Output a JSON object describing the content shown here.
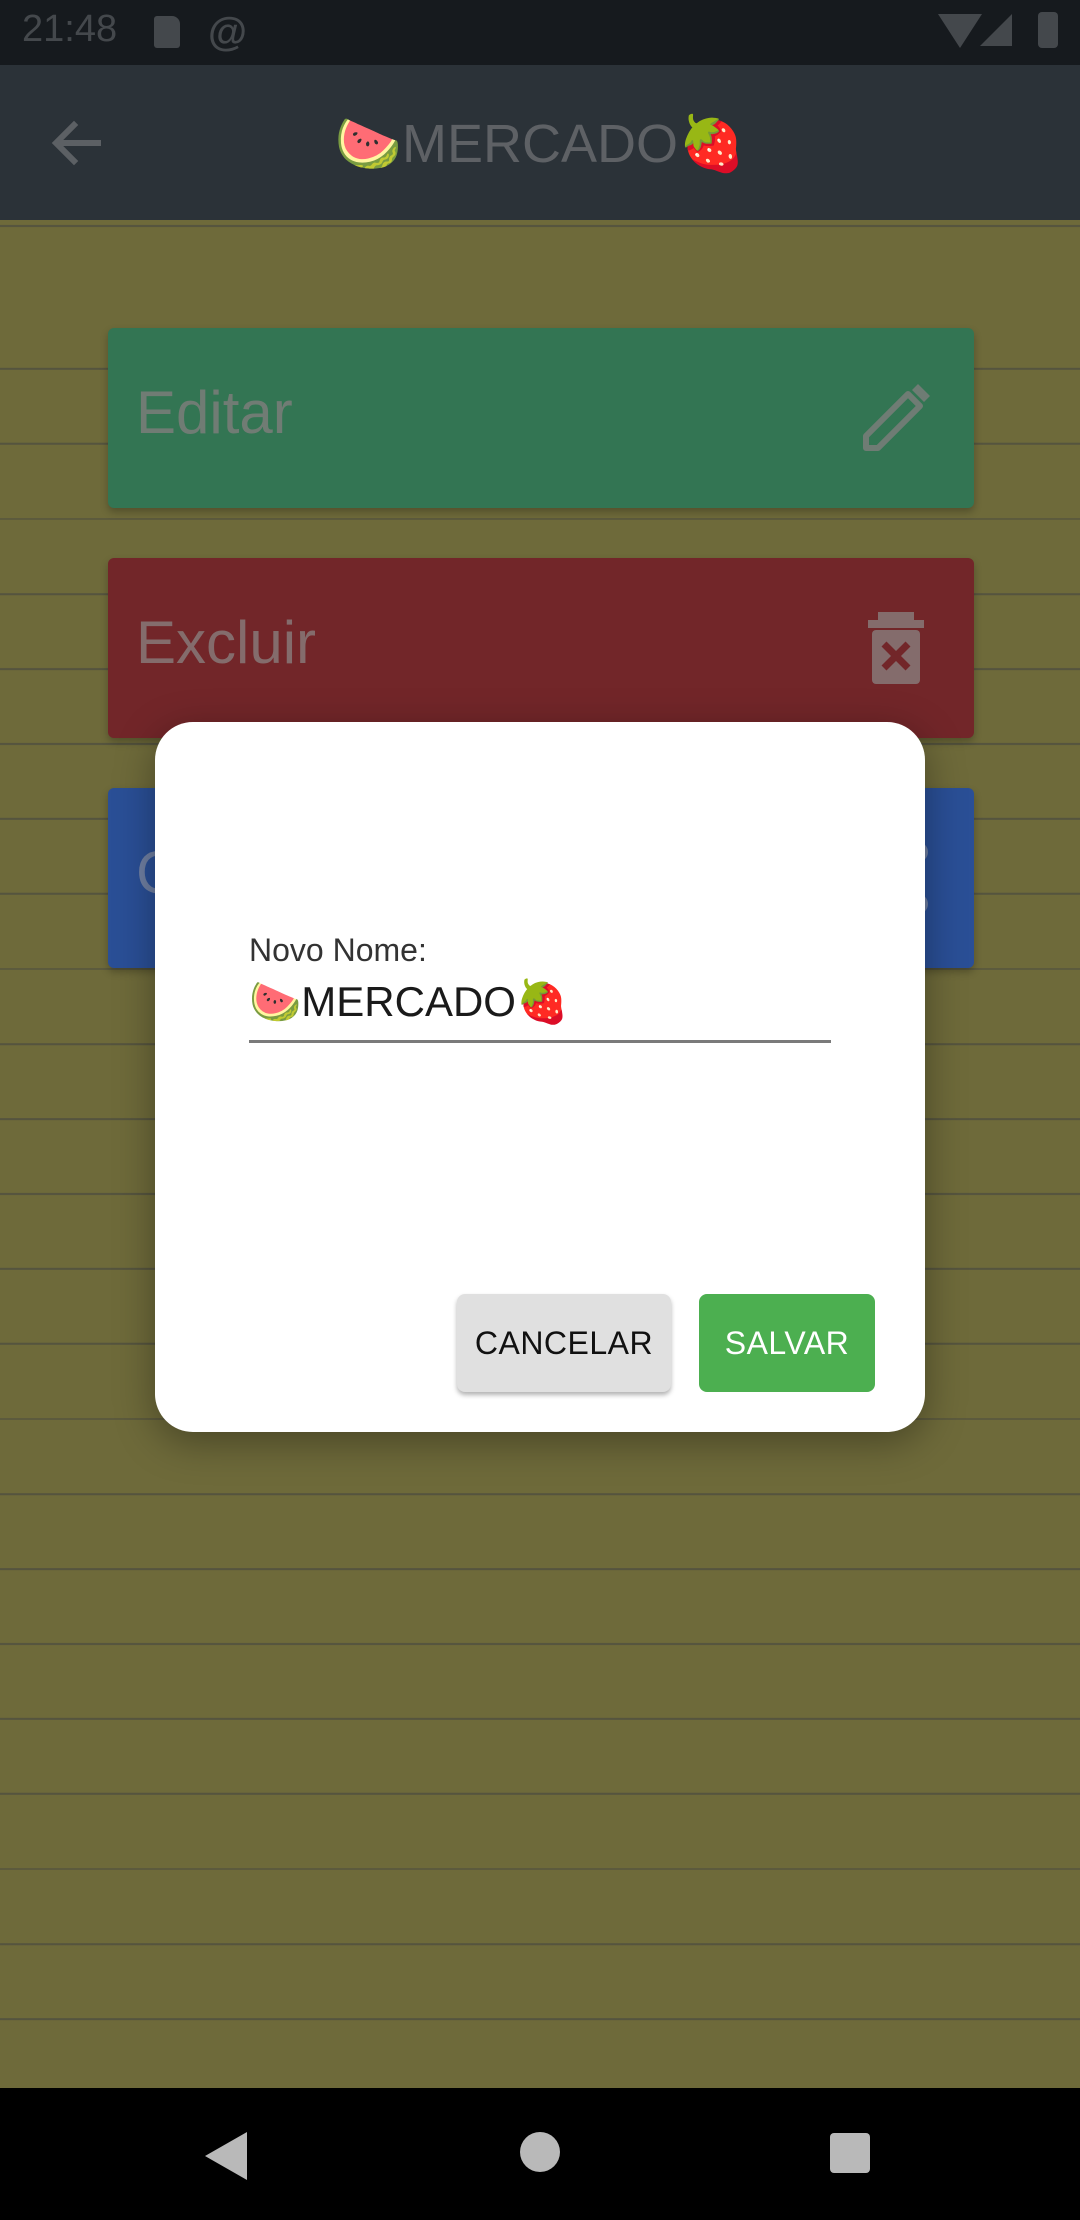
{
  "status_bar": {
    "time": "21:48",
    "icons": [
      "sd-card-icon",
      "at-icon",
      "wifi-icon",
      "signal-icon",
      "battery-icon"
    ]
  },
  "app_bar": {
    "title": "🍉MERCADO🍓",
    "back_icon": "arrow-back-icon"
  },
  "menu": {
    "items": [
      {
        "label": "Editar",
        "icon": "pencil-icon",
        "color": "#337553"
      },
      {
        "label": "Excluir",
        "icon": "trash-icon",
        "color": "#722629"
      },
      {
        "label": "C",
        "icon": "share-icon",
        "color": "#2a4f96"
      }
    ]
  },
  "dialog": {
    "field_label": "Novo Nome:",
    "field_value": "🍉MERCADO🍓",
    "cancel_label": "CANCELAR",
    "save_label": "SALVAR"
  },
  "colors": {
    "app_bar": "#2b3238",
    "page": "#6e6a3a",
    "save": "#4caf50",
    "cancel": "#e0e0e0"
  },
  "nav_bar": {
    "icons": [
      "nav-back-icon",
      "nav-home-icon",
      "nav-recent-icon"
    ]
  }
}
